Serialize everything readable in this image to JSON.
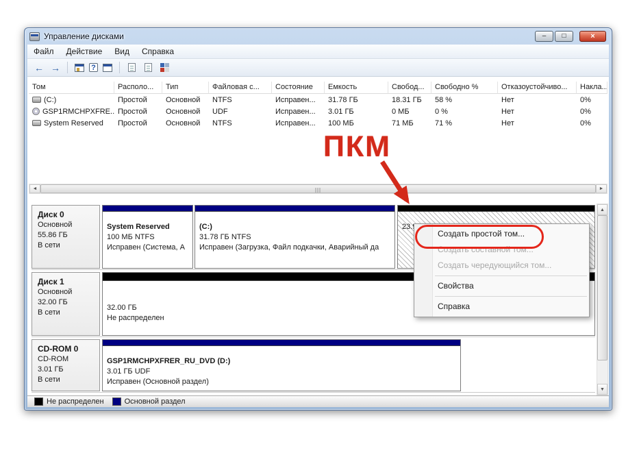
{
  "window": {
    "title": "Управление дисками",
    "minimize_glyph": "–",
    "maximize_glyph": "□",
    "close_glyph": "×"
  },
  "menubar": {
    "items": [
      "Файл",
      "Действие",
      "Вид",
      "Справка"
    ]
  },
  "toolbar": {
    "icons": [
      "back",
      "forward",
      "show-console-tree",
      "help",
      "console-window",
      "export-list",
      "properties",
      "disk-management-snapin"
    ],
    "back_glyph": "←",
    "forward_glyph": "→",
    "help_glyph": "?"
  },
  "volumes_table": {
    "columns": [
      "Том",
      "Располо...",
      "Тип",
      "Файловая с...",
      "Состояние",
      "Емкость",
      "Свобод...",
      "Свободно %",
      "Отказоустойчиво...",
      "Накла..."
    ],
    "rows": [
      {
        "icon": "hdd",
        "cells": [
          "(C:)",
          "Простой",
          "Основной",
          "NTFS",
          "Исправен...",
          "31.78 ГБ",
          "18.31 ГБ",
          "58 %",
          "Нет",
          "0%"
        ]
      },
      {
        "icon": "cd",
        "cells": [
          "GSP1RMCHPXFRE...",
          "Простой",
          "Основной",
          "UDF",
          "Исправен...",
          "3.01 ГБ",
          "0 МБ",
          "0 %",
          "Нет",
          "0%"
        ]
      },
      {
        "icon": "hdd",
        "cells": [
          "System Reserved",
          "Простой",
          "Основной",
          "NTFS",
          "Исправен...",
          "100 МБ",
          "71 МБ",
          "71 %",
          "Нет",
          "0%"
        ]
      }
    ]
  },
  "scrollbar": {
    "left": "◄",
    "right": "►",
    "up": "▲",
    "down": "▼"
  },
  "disks": [
    {
      "name": "Диск 0",
      "lines": [
        "Основной",
        "55.86 ГБ",
        "В сети"
      ],
      "partitions": [
        {
          "title": "System Reserved",
          "line2": "100 МБ NTFS",
          "line3": "Исправен (Система, А",
          "kind": "primary"
        },
        {
          "title": "(C:)",
          "line2": "31.78 ГБ NTFS",
          "line3": "Исправен (Загрузка, Файл подкачки, Аварийный да",
          "kind": "primary"
        },
        {
          "title": "23.9",
          "line2": "",
          "line3": "",
          "kind": "unallocated-selected"
        }
      ]
    },
    {
      "name": "Диск 1",
      "lines": [
        "Основной",
        "32.00 ГБ",
        "В сети"
      ],
      "partitions": [
        {
          "title": "32.00 ГБ",
          "line2": "Не распределен",
          "line3": "",
          "kind": "unallocated"
        }
      ]
    },
    {
      "name": "CD-ROM 0",
      "lines": [
        "CD-ROM",
        "3.01 ГБ",
        "В сети"
      ],
      "partitions": [
        {
          "title": "GSP1RMCHPXFRER_RU_DVD (D:)",
          "line2": "3.01 ГБ UDF",
          "line3": "Исправен (Основной раздел)",
          "kind": "primary"
        }
      ]
    }
  ],
  "context_menu": {
    "items": [
      {
        "label": "Создать простой том...",
        "enabled": true
      },
      {
        "label": "Создать составной том...",
        "enabled": false
      },
      {
        "label": "Создать чередующийся том...",
        "enabled": false
      },
      {
        "label": "Свойства",
        "enabled": true
      },
      {
        "label": "Справка",
        "enabled": true
      }
    ]
  },
  "legend": {
    "items": [
      {
        "label": "Не распределен",
        "color": "#000000"
      },
      {
        "label": "Основной раздел",
        "color": "#000080"
      }
    ]
  },
  "annotation": {
    "label": "ПКМ",
    "color": "#d32a1a"
  },
  "colors": {
    "primary_partition": "#000082",
    "unallocated": "#000000"
  }
}
